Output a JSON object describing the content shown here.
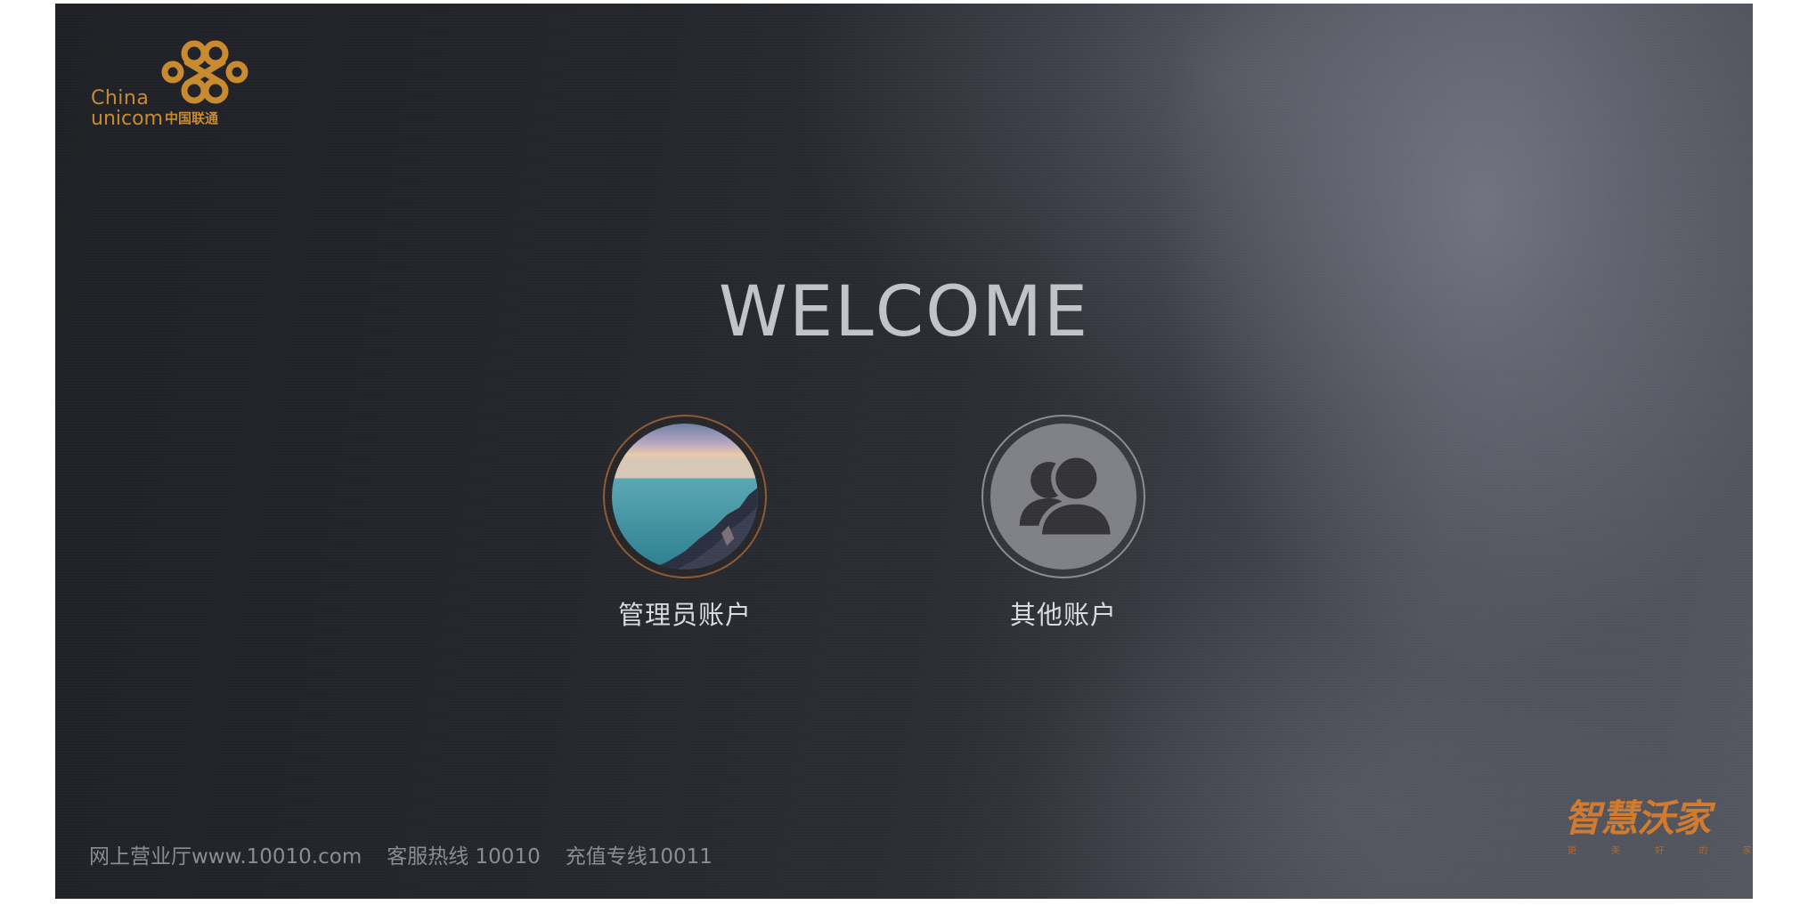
{
  "logo": {
    "brand_en_line1": "China",
    "brand_en_line2": "unicom",
    "brand_cn": "中国联通"
  },
  "welcome_title": "WELCOME",
  "accounts": [
    {
      "label": "管理员账户",
      "avatar": "landscape-photo"
    },
    {
      "label": "其他账户",
      "avatar": "users-icon"
    }
  ],
  "footer": {
    "website": "网上营业厅www.10010.com",
    "hotline": "客服热线 10010",
    "recharge": "充值专线10011"
  },
  "brand": {
    "title": "智慧沃家",
    "subtitle": "更 美 好 的 家"
  },
  "colors": {
    "logo_orange": "#c88a2e",
    "brand_orange": "#d07a2e"
  }
}
